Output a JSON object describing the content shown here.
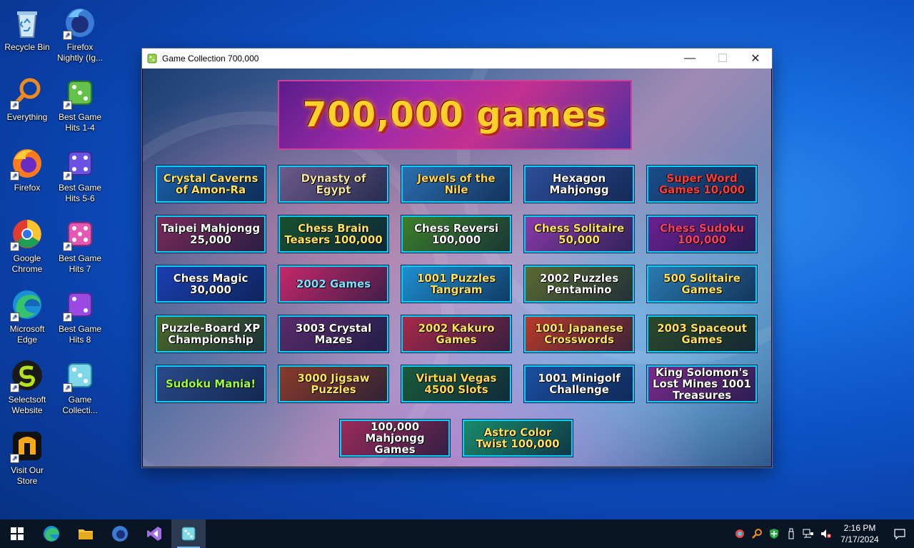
{
  "desktop": {
    "icons": [
      {
        "label": "Recycle Bin"
      },
      {
        "label": "Firefox Nightly (Ig..."
      },
      {
        "label": "Everything"
      },
      {
        "label": "Best Game Hits 1-4"
      },
      {
        "label": "Firefox"
      },
      {
        "label": "Best Game Hits 5-6"
      },
      {
        "label": "Google Chrome"
      },
      {
        "label": "Best Game Hits 7"
      },
      {
        "label": "Microsoft Edge"
      },
      {
        "label": "Best Game Hits 8"
      },
      {
        "label": "Selectsoft Website"
      },
      {
        "label": "Game Collecti..."
      },
      {
        "label": "Visit Our Store"
      }
    ]
  },
  "window": {
    "title": "Game Collection 700,000",
    "minimize": "—",
    "maximize": "☐",
    "close": "✕",
    "banner": "700,000 games",
    "games": [
      {
        "label": "Crystal Caverns of Amon-Ra",
        "bg": "#1a5fa8",
        "fg": "#ffe25a"
      },
      {
        "label": "Dynasty of Egypt",
        "bg": "#6c5a8a",
        "fg": "#f2e3a0"
      },
      {
        "label": "Jewels of the Nile",
        "bg": "#2a6fb0",
        "fg": "#ffd84a"
      },
      {
        "label": "Hexagon Mahjongg",
        "bg": "#2d4e9a",
        "fg": "#ffffff"
      },
      {
        "label": "Super Word Games 10,000",
        "bg": "#1a4d8a",
        "fg": "#ff3b3b"
      },
      {
        "label": "Taipei Mahjongg 25,000",
        "bg": "#7a2a5a",
        "fg": "#ffffff"
      },
      {
        "label": "Chess Brain Teasers 100,000",
        "bg": "#17502f",
        "fg": "#ffe25a"
      },
      {
        "label": "Chess Reversi 100,000",
        "bg": "#3d7f2a",
        "fg": "#ffffff"
      },
      {
        "label": "Chess Solitaire 50,000",
        "bg": "#8b3aa8",
        "fg": "#ffe25a"
      },
      {
        "label": "Chess Sudoku 100,000",
        "bg": "#6a2090",
        "fg": "#ff3b6a"
      },
      {
        "label": "Chess Magic 30,000",
        "bg": "#1a3fb0",
        "fg": "#ffffff"
      },
      {
        "label": "2002 Games",
        "bg": "#c6286a",
        "fg": "#7ee0ff"
      },
      {
        "label": "1001 Puzzles Tangram",
        "bg": "#1e8fd0",
        "fg": "#ffe25a"
      },
      {
        "label": "2002 Puzzles Pentamino",
        "bg": "#5a6a30",
        "fg": "#ffffff"
      },
      {
        "label": "500 Solitaire Games",
        "bg": "#2a7ab0",
        "fg": "#ffe25a"
      },
      {
        "label": "Puzzle-Board XP Championship",
        "bg": "#4a6a2a",
        "fg": "#ffffff"
      },
      {
        "label": "3003 Crystal Mazes",
        "bg": "#5a2a6a",
        "fg": "#ffffff"
      },
      {
        "label": "2002 Kakuro Games",
        "bg": "#a82a4a",
        "fg": "#ffe25a"
      },
      {
        "label": "1001 Japanese Crosswords",
        "bg": "#b83a2a",
        "fg": "#ffe25a"
      },
      {
        "label": "2003 Spaceout Games",
        "bg": "#2a4a2a",
        "fg": "#ffe25a"
      },
      {
        "label": "Sudoku Mania!",
        "bg": "#2a4a8a",
        "fg": "#9aff3a"
      },
      {
        "label": "3000 Jigsaw Puzzles",
        "bg": "#8a3a2a",
        "fg": "#ffe25a"
      },
      {
        "label": "Virtual Vegas 4500 Slots",
        "bg": "#1a5a3a",
        "fg": "#ffd84a"
      },
      {
        "label": "1001 Minigolf Challenge",
        "bg": "#1a4fa0",
        "fg": "#ffffff"
      },
      {
        "label": "King Solomon's Lost Mines 1001 Treasures",
        "bg": "#7a2a8a",
        "fg": "#ffffff"
      },
      {
        "label": "100,000 Mahjongg Games",
        "bg": "#9a2a5a",
        "fg": "#ffffff"
      },
      {
        "label": "Astro Color Twist 100,000",
        "bg": "#1a8a6a",
        "fg": "#ffe25a"
      }
    ]
  },
  "taskbar": {
    "items": [
      "windows-start",
      "edge",
      "file-explorer",
      "firefox-nightly",
      "visual-studio",
      "game-collection"
    ],
    "clock": {
      "time": "2:16 PM",
      "date": "7/17/2024"
    }
  }
}
